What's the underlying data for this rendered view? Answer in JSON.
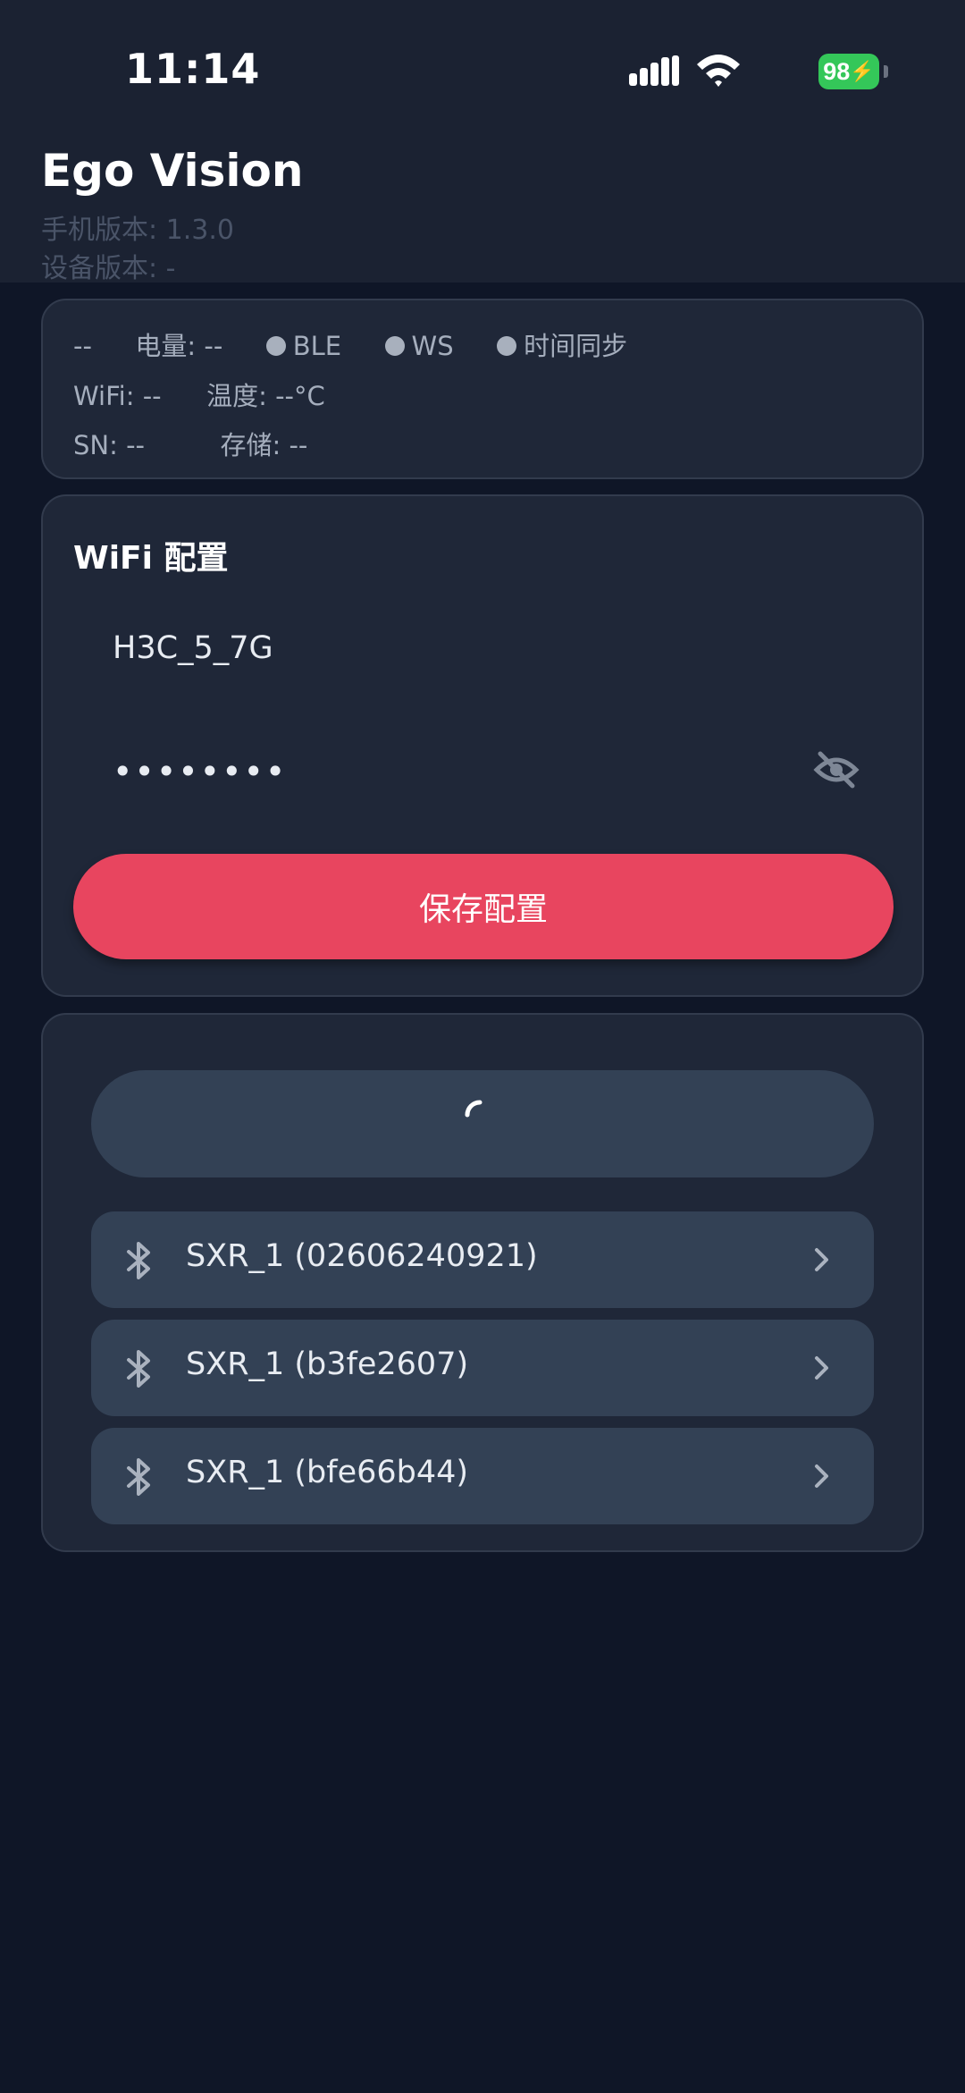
{
  "status_bar": {
    "time": "11:14",
    "battery": "98",
    "icons": [
      "signal-icon",
      "wifi-icon",
      "battery-charging-icon"
    ]
  },
  "header": {
    "title": "Ego Vision",
    "phone_version": "手机版本: 1.3.0",
    "device_version": "设备版本: -"
  },
  "device_info": {
    "name": "--",
    "battery": "电量: --",
    "ble": "BLE",
    "ws": "WS",
    "time_sync": "时间同步",
    "wifi": "WiFi: --",
    "temperature": "温度: --°C",
    "sn": "SN: --",
    "storage": "存储: --",
    "indicator_color": "#a8b0bd"
  },
  "wifi_config": {
    "title": "WiFi 配置",
    "ssid": "H3C_5_7G",
    "password_masked": "••••••••",
    "save_label": "保存配置"
  },
  "devices": {
    "scanning": true,
    "items": [
      {
        "label": "SXR_1 (02606240921)"
      },
      {
        "label": "SXR_1 (b3fe2607)"
      },
      {
        "label": "SXR_1 (bfe66b44)"
      }
    ]
  },
  "colors": {
    "background": "#0f1627",
    "card": "#1f2738",
    "accent": "#e8455f",
    "item": "#334155",
    "battery": "#34c759"
  }
}
